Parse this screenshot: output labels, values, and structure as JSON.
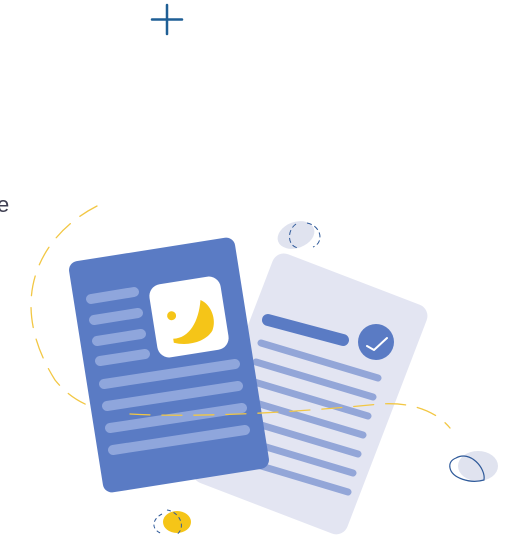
{
  "edge_text": "e",
  "palette": {
    "front_document": "#5a7bc4",
    "front_lines": "#8fa6dc",
    "back_document": "#e3e5f2",
    "back_lines": "#93a6d8",
    "accent_yellow": "#f5c518",
    "orbit_line": "#f2c744",
    "plus_sign": "#1f5f95",
    "pebble": "#e0e3ef",
    "outline": "#2f5a9a"
  },
  "icons": {
    "image_icon": "image-icon",
    "check_badge": "check-badge-icon",
    "plus": "plus-icon"
  }
}
